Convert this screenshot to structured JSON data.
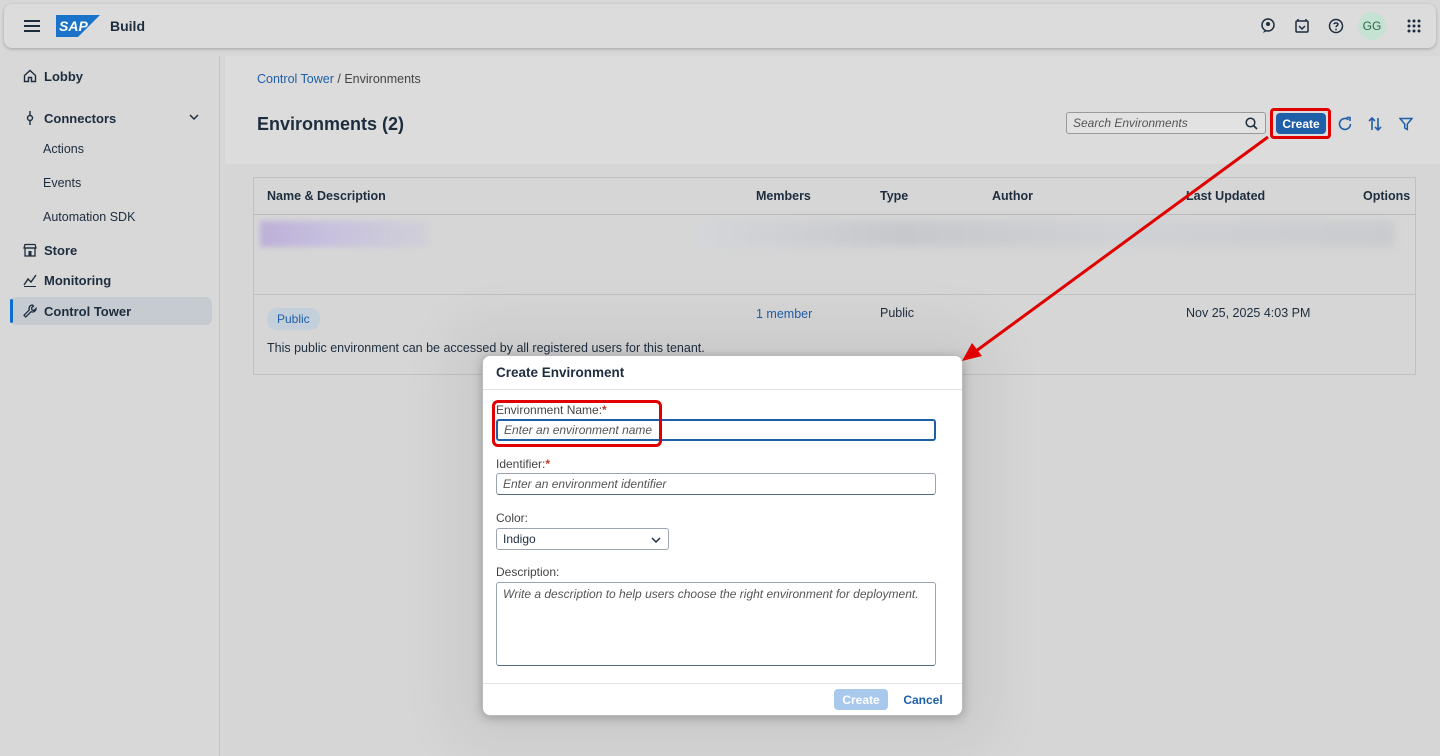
{
  "shell": {
    "logo_text": "SAP",
    "product": "Build",
    "avatar_initials": "GG"
  },
  "sidebar": {
    "items": [
      {
        "label": "Lobby"
      },
      {
        "label": "Connectors"
      },
      {
        "label": "Actions"
      },
      {
        "label": "Events"
      },
      {
        "label": "Automation SDK"
      },
      {
        "label": "Store"
      },
      {
        "label": "Monitoring"
      },
      {
        "label": "Control Tower"
      }
    ]
  },
  "breadcrumb": {
    "link": "Control Tower",
    "separator": "/",
    "current": "Environments"
  },
  "page": {
    "title": "Environments (2)",
    "search_placeholder": "Search Environments",
    "create_label": "Create"
  },
  "table": {
    "headers": [
      "Name & Description",
      "Members",
      "Type",
      "Author",
      "Last Updated",
      "Options"
    ],
    "rows": [
      {
        "badge": "Public",
        "description": "This public environment can be accessed by all registered users for this tenant.",
        "members": "1 member",
        "type": "Public",
        "author": "",
        "last_updated": "Nov 25, 2025 4:03 PM"
      }
    ]
  },
  "dialog": {
    "title": "Create Environment",
    "name_label": "Environment Name:",
    "name_placeholder": "Enter an environment name",
    "identifier_label": "Identifier:",
    "identifier_placeholder": "Enter an environment identifier",
    "color_label": "Color:",
    "color_value": "Indigo",
    "description_label": "Description:",
    "description_placeholder": "Write a description to help users choose the right environment for deployment.",
    "create_label": "Create",
    "cancel_label": "Cancel",
    "required_mark": "*"
  },
  "colors": {
    "accent": "#1f5fa8",
    "highlight": "#e00000",
    "badge_bg": "#c3cfda",
    "avatar_bg": "#c6e2d3"
  }
}
